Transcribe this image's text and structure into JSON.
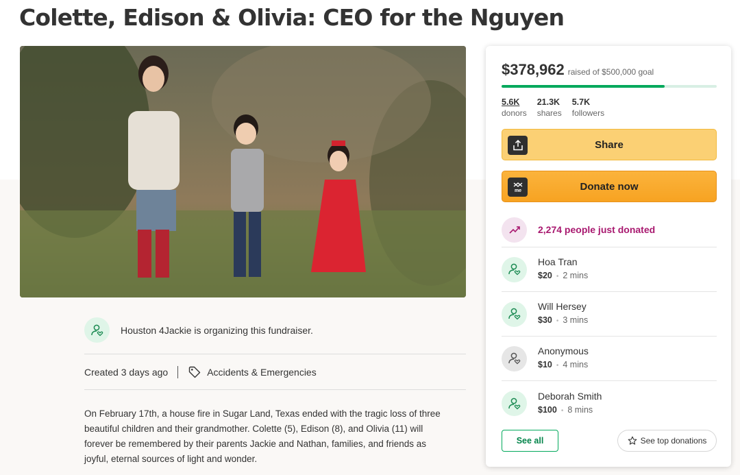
{
  "page": {
    "title": "Colette, Edison & Olivia: CEO for the Nguyen"
  },
  "organizer": {
    "text": "Houston 4Jackie is organizing this fundraiser."
  },
  "meta": {
    "created": "Created 3 days ago",
    "category": "Accidents & Emergencies"
  },
  "story": {
    "lines": [
      "On February 17th, a house fire in Sugar Land, Texas ended with the tragic loss of three",
      "beautiful children and their grandmother.  Colette (5), Edison (8), and Olivia (11) will",
      "forever be remembered by their parents Jackie and Nathan, families, and friends as",
      "joyful, eternal sources of light and wonder."
    ]
  },
  "donation_card": {
    "raised": "$378,962",
    "goal_text": "raised of $500,000 goal",
    "progress_fraction": 0.758,
    "stats": [
      {
        "num": "5.6K",
        "label": "donors"
      },
      {
        "num": "21.3K",
        "label": "shares"
      },
      {
        "num": "5.7K",
        "label": "followers"
      }
    ],
    "share_label": "Share",
    "donate_label": "Donate now",
    "trend_text": "2,274 people just donated",
    "donors": [
      {
        "name": "Hoa Tran",
        "amount": "$20",
        "time": "2 mins"
      },
      {
        "name": "Will Hersey",
        "amount": "$30",
        "time": "3 mins"
      },
      {
        "name": "Anonymous",
        "amount": "$10",
        "time": "4 mins"
      },
      {
        "name": "Deborah Smith",
        "amount": "$100",
        "time": "8 mins"
      }
    ],
    "see_all_label": "See all",
    "see_top_label": "See top donations"
  },
  "colors": {
    "brand_green": "#02a95c",
    "donate_orange": "#f7a322",
    "share_yellow": "#fbd074",
    "trend_purple": "#a8186f"
  },
  "icons": {
    "share": "share-upload-icon",
    "donate": "gofundme-logo-icon",
    "trend": "trending-up-icon",
    "donor": "user-heart-icon",
    "category": "tag-icon",
    "see_top": "star-icon"
  }
}
